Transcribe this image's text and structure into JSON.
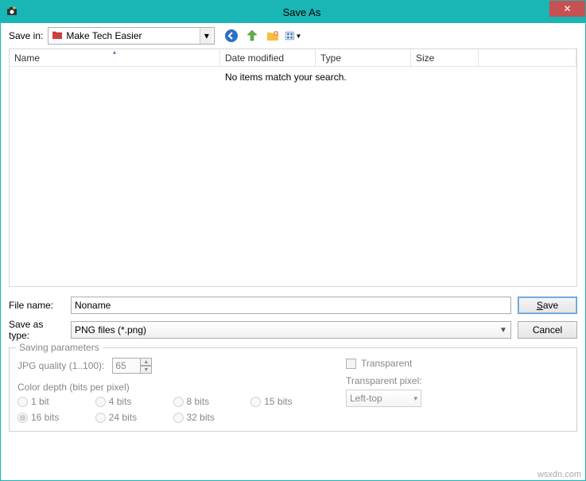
{
  "title": "Save As",
  "save_in_label": "Save in:",
  "folder_name": "Make Tech Easier",
  "columns": {
    "name": "Name",
    "date": "Date modified",
    "type": "Type",
    "size": "Size"
  },
  "empty_message": "No items match your search.",
  "filename_label": "File name:",
  "filename_value": "Noname",
  "savetype_label": "Save as type:",
  "savetype_value": "PNG files (*.png)",
  "buttons": {
    "save": "Save",
    "cancel": "Cancel"
  },
  "params": {
    "legend": "Saving parameters",
    "jpg_label": "JPG quality (1..100):",
    "jpg_value": "65",
    "depth_label": "Color depth (bits per pixel)",
    "depth_options": [
      "1 bit",
      "4 bits",
      "8 bits",
      "15 bits",
      "16 bits",
      "24 bits",
      "32 bits"
    ],
    "depth_selected": "16 bits",
    "transparent_label": "Transparent",
    "transparent_pixel_label": "Transparent pixel:",
    "transparent_pixel_value": "Left-top"
  },
  "watermark": "wsxdn.com"
}
